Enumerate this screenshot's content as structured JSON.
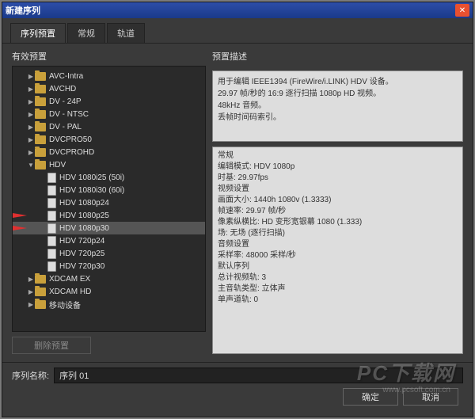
{
  "window": {
    "title": "新建序列"
  },
  "tabs": [
    {
      "label": "序列预置",
      "active": true
    },
    {
      "label": "常规",
      "active": false
    },
    {
      "label": "轨道",
      "active": false
    }
  ],
  "leftPanel": {
    "title": "有效预置"
  },
  "tree": [
    {
      "type": "folder",
      "label": "AVC-Intra",
      "expanded": false,
      "level": 1
    },
    {
      "type": "folder",
      "label": "AVCHD",
      "expanded": false,
      "level": 1
    },
    {
      "type": "folder",
      "label": "DV - 24P",
      "expanded": false,
      "level": 1
    },
    {
      "type": "folder",
      "label": "DV - NTSC",
      "expanded": false,
      "level": 1
    },
    {
      "type": "folder",
      "label": "DV - PAL",
      "expanded": false,
      "level": 1
    },
    {
      "type": "folder",
      "label": "DVCPRO50",
      "expanded": false,
      "level": 1
    },
    {
      "type": "folder",
      "label": "DVCPROHD",
      "expanded": false,
      "level": 1
    },
    {
      "type": "folder",
      "label": "HDV",
      "expanded": true,
      "level": 1
    },
    {
      "type": "doc",
      "label": "HDV 1080i25 (50i)",
      "level": 2
    },
    {
      "type": "doc",
      "label": "HDV 1080i30 (60i)",
      "level": 2
    },
    {
      "type": "doc",
      "label": "HDV 1080p24",
      "level": 2
    },
    {
      "type": "doc",
      "label": "HDV 1080p25",
      "level": 2,
      "arrow": true
    },
    {
      "type": "doc",
      "label": "HDV 1080p30",
      "level": 2,
      "selected": true,
      "arrow": true
    },
    {
      "type": "doc",
      "label": "HDV 720p24",
      "level": 2
    },
    {
      "type": "doc",
      "label": "HDV 720p25",
      "level": 2
    },
    {
      "type": "doc",
      "label": "HDV 720p30",
      "level": 2
    },
    {
      "type": "folder",
      "label": "XDCAM EX",
      "expanded": false,
      "level": 1
    },
    {
      "type": "folder",
      "label": "XDCAM HD",
      "expanded": false,
      "level": 1
    },
    {
      "type": "folder",
      "label": "移动设备",
      "expanded": false,
      "level": 1
    }
  ],
  "rightPanel": {
    "title": "预置描述"
  },
  "description": {
    "line1": "用于编辑 IEEE1394 (FireWire/i.LINK) HDV 设备。",
    "line2": "29.97 帧/秒的 16:9 逐行扫描 1080p HD 视频。",
    "line3": "48kHz 音频。",
    "line4": "丢帧时间码索引。"
  },
  "details": {
    "l1": "常规",
    "l2": "编辑模式: HDV 1080p",
    "l3": "时基: 29.97fps",
    "l4": "",
    "l5": "视频设置",
    "l6": "画面大小: 1440h 1080v (1.3333)",
    "l7": "帧速率: 29.97 帧/秒",
    "l8": "像素纵横比: HD 变形宽银幕 1080 (1.333)",
    "l9": "场: 无场 (逐行扫描)",
    "l10": "",
    "l11": "音频设置",
    "l12": "采样率: 48000 采样/秒",
    "l13": "",
    "l14": "默认序列",
    "l15": "总计视频轨: 3",
    "l16": "主音轨类型: 立体声",
    "l17": "单声道轨: 0"
  },
  "deleteBtn": "删除预置",
  "footer": {
    "label": "序列名称:",
    "value": "序列 01"
  },
  "buttons": {
    "ok": "确定",
    "cancel": "取消"
  },
  "watermark": {
    "main": "PC下载网",
    "sub": "www.pcsoft.com.cn"
  }
}
